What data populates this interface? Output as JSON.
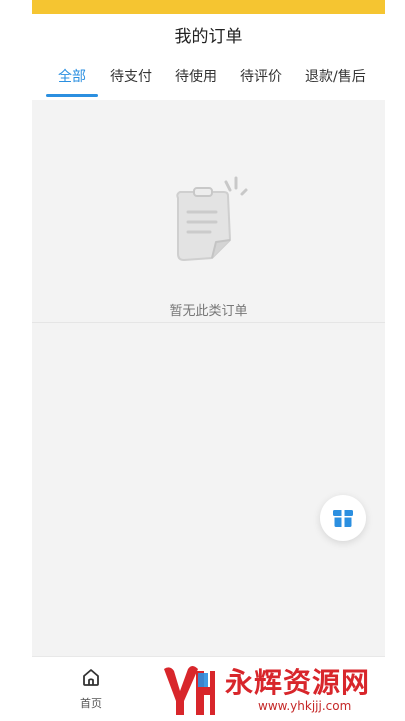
{
  "page": {
    "title": "我的订单"
  },
  "tabs": [
    {
      "label": "全部",
      "active": true
    },
    {
      "label": "待支付",
      "active": false
    },
    {
      "label": "待使用",
      "active": false
    },
    {
      "label": "待评价",
      "active": false
    },
    {
      "label": "退款/售后",
      "active": false
    }
  ],
  "empty_state": {
    "message": "暂无此类订单",
    "icon": "empty-order-clipboard-icon"
  },
  "fab": {
    "icon": "gift-box-icon"
  },
  "bottom_nav": {
    "items": [
      {
        "label": "首页",
        "icon": "home-icon"
      }
    ]
  },
  "watermark": {
    "title": "永辉资源网",
    "url": "www.yhkjjj.com"
  },
  "colors": {
    "accent": "#2b8fe0",
    "status_strip": "#f5c531",
    "watermark_red": "#d8262b"
  }
}
